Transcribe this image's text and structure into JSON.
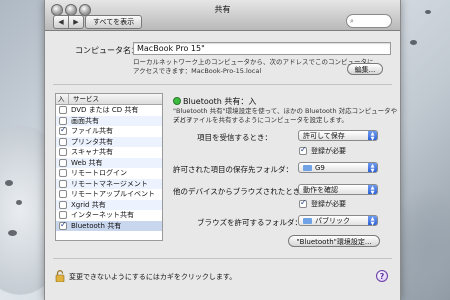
{
  "window": {
    "title": "共有",
    "show_all": "すべてを表示"
  },
  "computer": {
    "label": "コンピュータ名：",
    "name": "MacBook Pro 15\"",
    "desc_line1": "ローカルネットワーク上のコンピュータから、次のアドレスでこのコンピュータに",
    "desc_line2": "アクセスできます：MacBook-Pro-15.local",
    "edit_button": "編集..."
  },
  "services": {
    "header_on": "入",
    "header_service": "サービス",
    "items": [
      {
        "label": "DVD または CD 共有",
        "checked": false
      },
      {
        "label": "画面共有",
        "checked": false
      },
      {
        "label": "ファイル共有",
        "checked": true
      },
      {
        "label": "プリンタ共有",
        "checked": false
      },
      {
        "label": "スキャナ共有",
        "checked": false
      },
      {
        "label": "Web 共有",
        "checked": false
      },
      {
        "label": "リモートログイン",
        "checked": false
      },
      {
        "label": "リモートマネージメント",
        "checked": false
      },
      {
        "label": "リモートアップルイベント",
        "checked": false
      },
      {
        "label": "Xgrid 共有",
        "checked": false
      },
      {
        "label": "インターネット共有",
        "checked": false
      },
      {
        "label": "Bluetooth 共有",
        "checked": true,
        "selected": true
      }
    ]
  },
  "bluetooth": {
    "status": "Bluetooth 共有：入",
    "desc_line1": "\"Bluetooth 共有\"環境設定を使って、ほかの Bluetooth 対応コンピュータやデバイ",
    "desc_line2": "スとファイルを共有するようにコンピュータを設定します。",
    "receive_label": "項目を受信するとき：",
    "receive_value": "許可して保存",
    "require_pairing": "登録が必要",
    "save_folder_label": "許可された項目の保存先フォルダ：",
    "save_folder_value": "G9",
    "browse_label": "他のデバイスからブラウズされたとき：",
    "browse_value": "動作を確認",
    "require_pairing2": "登録が必要",
    "browse_folder_label": "ブラウズを許可するフォルダ：",
    "browse_folder_value": "パブリック",
    "prefs_button": "\"Bluetooth\"環境設定..."
  },
  "footer": {
    "lock_text": "変更できないようにするにはカギをクリックします。",
    "help": "?"
  },
  "colors": {
    "status_green": "#3cbb3c",
    "popup_arrow_blue": "#2f63d8"
  }
}
